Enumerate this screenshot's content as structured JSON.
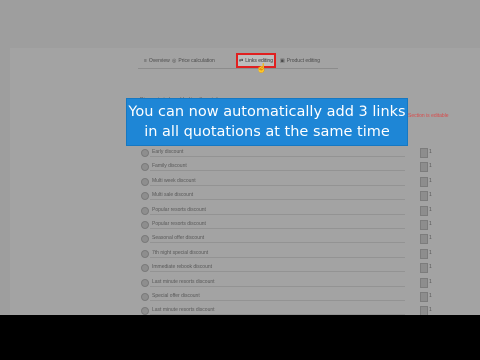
{
  "toolbar": {
    "items": [
      {
        "icon": "≡",
        "label": "Overview"
      },
      {
        "icon": "◎",
        "label": "Price calculation"
      },
      {
        "icon": "⇄",
        "label": "Links editing"
      },
      {
        "icon": "▣",
        "label": "Product editing"
      }
    ]
  },
  "section": {
    "heading": "Discounts to be added to all quotations",
    "warning": "Section is editable"
  },
  "discounts": [
    {
      "label": "Early discount",
      "value": "1"
    },
    {
      "label": "Family discount",
      "value": "1"
    },
    {
      "label": "Multi week discount",
      "value": "1"
    },
    {
      "label": "Multi sale discount",
      "value": "1"
    },
    {
      "label": "Popular resorts discount",
      "value": "1"
    },
    {
      "label": "Popular resorts discount",
      "value": "1"
    },
    {
      "label": "Seasonal offer discount",
      "value": "1"
    },
    {
      "label": "7th night special discount",
      "value": "1"
    },
    {
      "label": "Immediate rebook discount",
      "value": "1"
    },
    {
      "label": "Last minute resorts discount",
      "value": "1"
    },
    {
      "label": "Special offer discount",
      "value": "1"
    },
    {
      "label": "Last minute resorts discount",
      "value": "1"
    }
  ],
  "banner": {
    "line1": "You can now automatically add 3 links",
    "line2": "in all quotations at the same time"
  },
  "colors": {
    "banner_bg": "#1e86d6",
    "highlight_border": "#e02020",
    "warning_text": "#d94a4a"
  }
}
